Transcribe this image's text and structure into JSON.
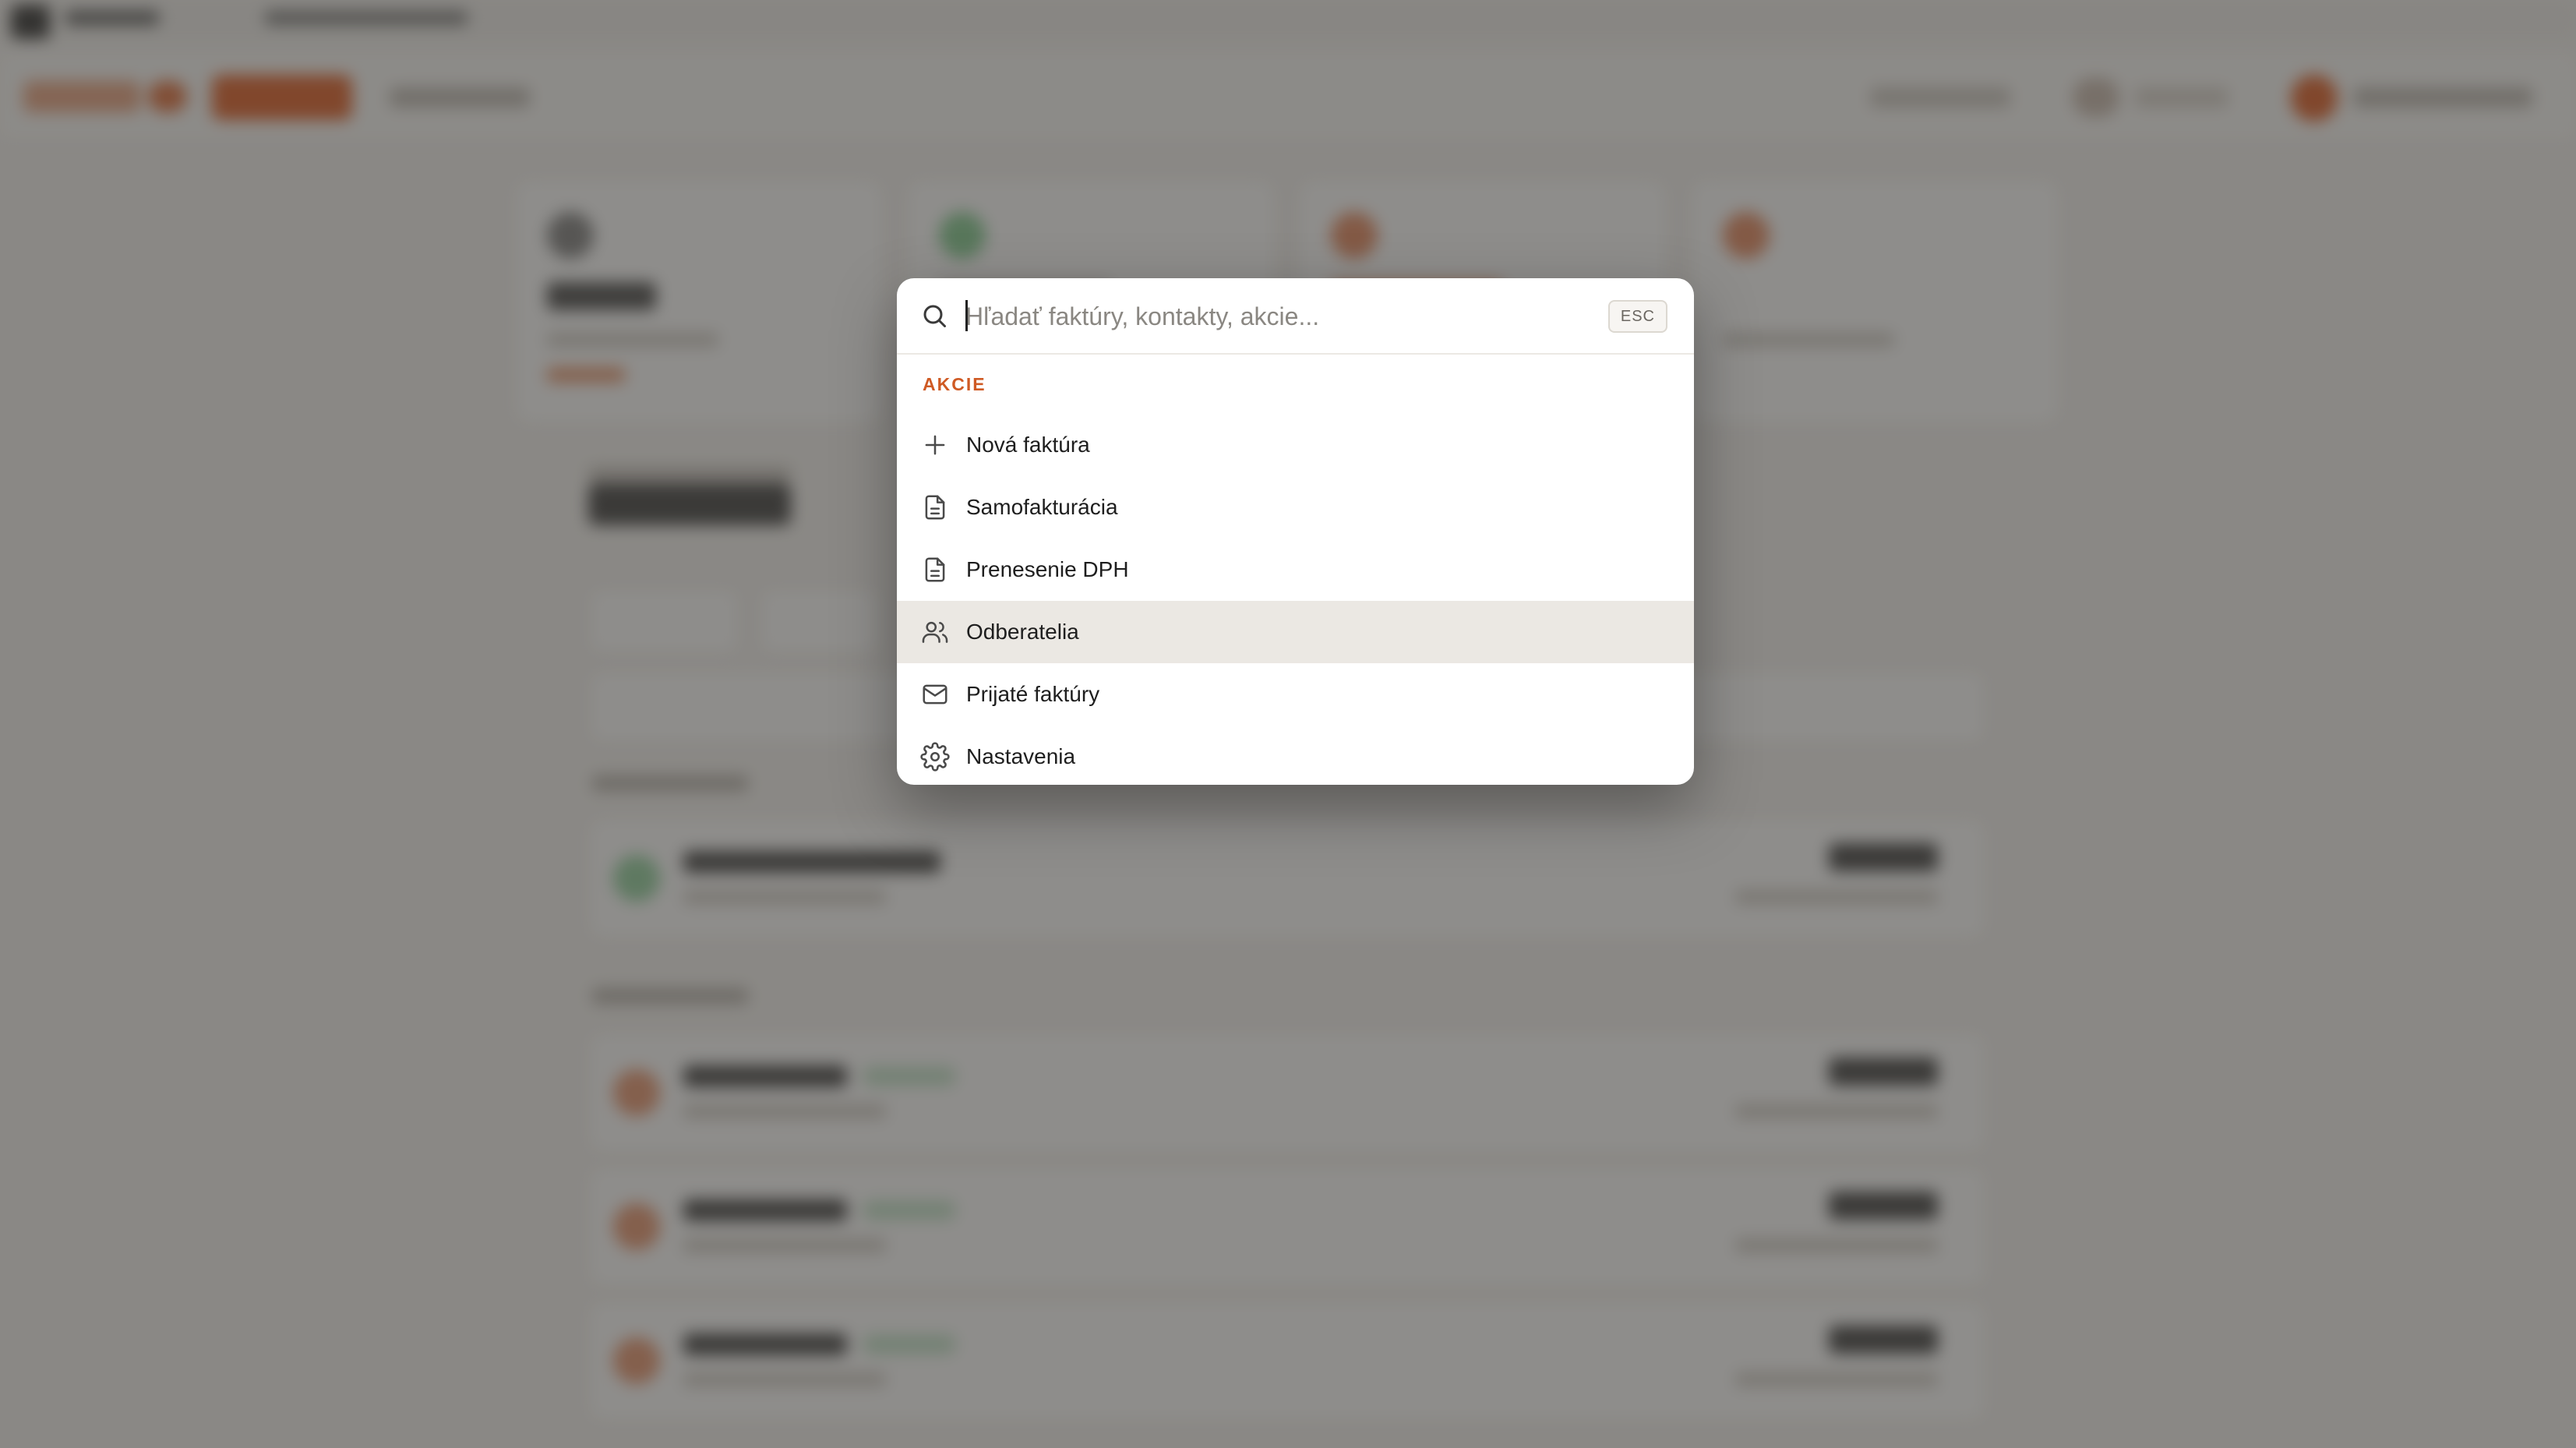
{
  "search": {
    "placeholder": "Hľadať faktúry, kontakty, akcie...",
    "esc_label": "ESC"
  },
  "groups": [
    {
      "heading": "AKCIE",
      "items": [
        {
          "label": "Nová faktúra",
          "icon": "plus-icon"
        },
        {
          "label": "Samofakturácia",
          "icon": "document-icon"
        },
        {
          "label": "Prenesenie DPH",
          "icon": "document-icon"
        },
        {
          "label": "Odberatelia",
          "icon": "users-icon",
          "highlighted": true
        },
        {
          "label": "Prijaté faktúry",
          "icon": "mail-icon"
        },
        {
          "label": "Nastavenia",
          "icon": "gear-icon"
        }
      ]
    }
  ],
  "colors": {
    "accent": "#cf5a24",
    "highlight_row": "#ebe8e3",
    "overlay": "rgba(60,58,55,0.58)"
  }
}
